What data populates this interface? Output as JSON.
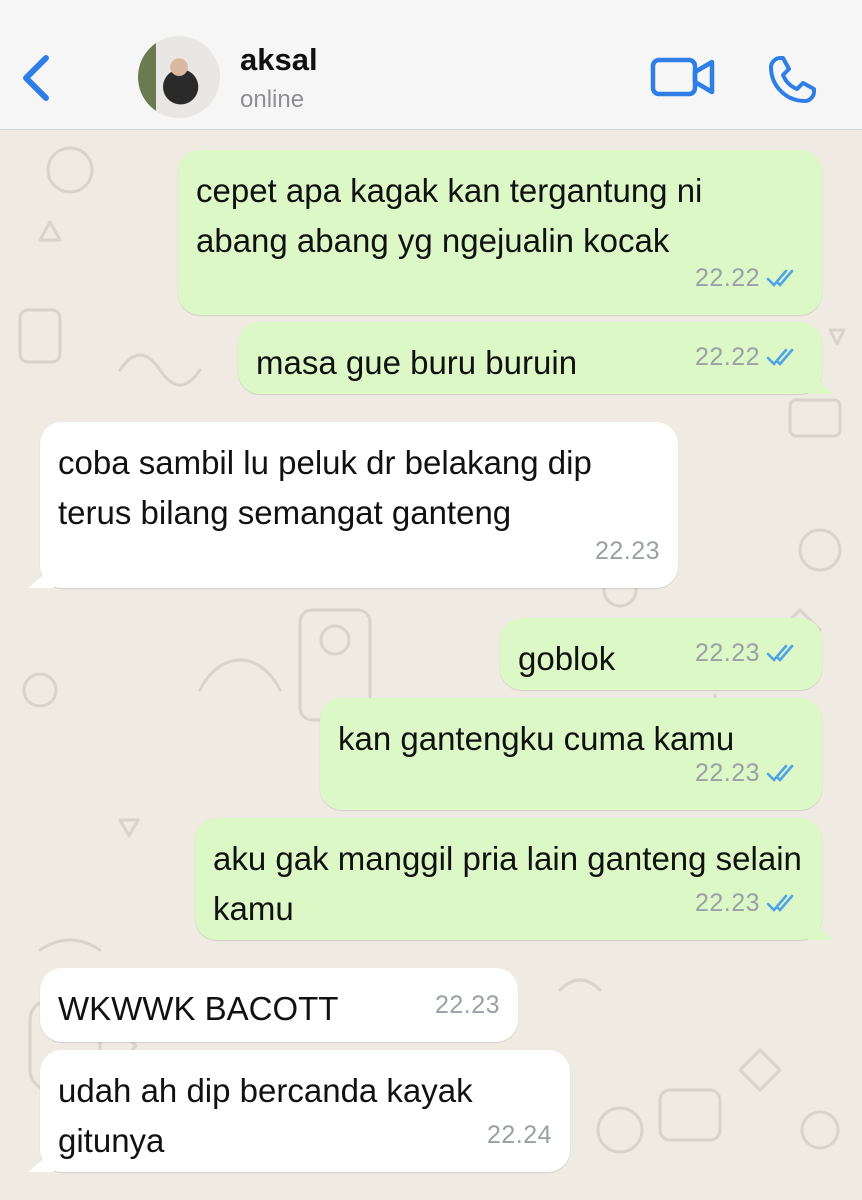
{
  "header": {
    "contact_name": "aksal",
    "contact_status": "online",
    "icons": [
      "chevron-left-icon",
      "avatar",
      "video-call-icon",
      "phone-icon"
    ],
    "accent_color": "#2f7ee6"
  },
  "messages": [
    {
      "direction": "out",
      "text": "cepet apa kagak kan tergantung ni abang abang yg ngejualin kocak",
      "time": "22.22",
      "read": true
    },
    {
      "direction": "out",
      "text": "masa gue buru buruin",
      "time": "22.22",
      "read": true
    },
    {
      "direction": "in",
      "text": "coba sambil lu peluk dr belakang dip terus bilang semangat ganteng",
      "time": "22.23"
    },
    {
      "direction": "out",
      "text": "goblok",
      "time": "22.23",
      "read": true
    },
    {
      "direction": "out",
      "text": "kan gantengku cuma kamu",
      "time": "22.23",
      "read": true
    },
    {
      "direction": "out",
      "text": "aku gak manggil pria lain ganteng selain kamu",
      "time": "22.23",
      "read": true
    },
    {
      "direction": "in",
      "text": "WKWWK BACOTT",
      "time": "22.23"
    },
    {
      "direction": "in",
      "text": "udah ah dip bercanda kayak gitunya",
      "time": "22.24"
    }
  ],
  "colors": {
    "outgoing_bubble": "#dcf8c6",
    "incoming_bubble": "#ffffff",
    "chat_background": "#efeae2",
    "read_ticks": "#4fa3e8"
  }
}
